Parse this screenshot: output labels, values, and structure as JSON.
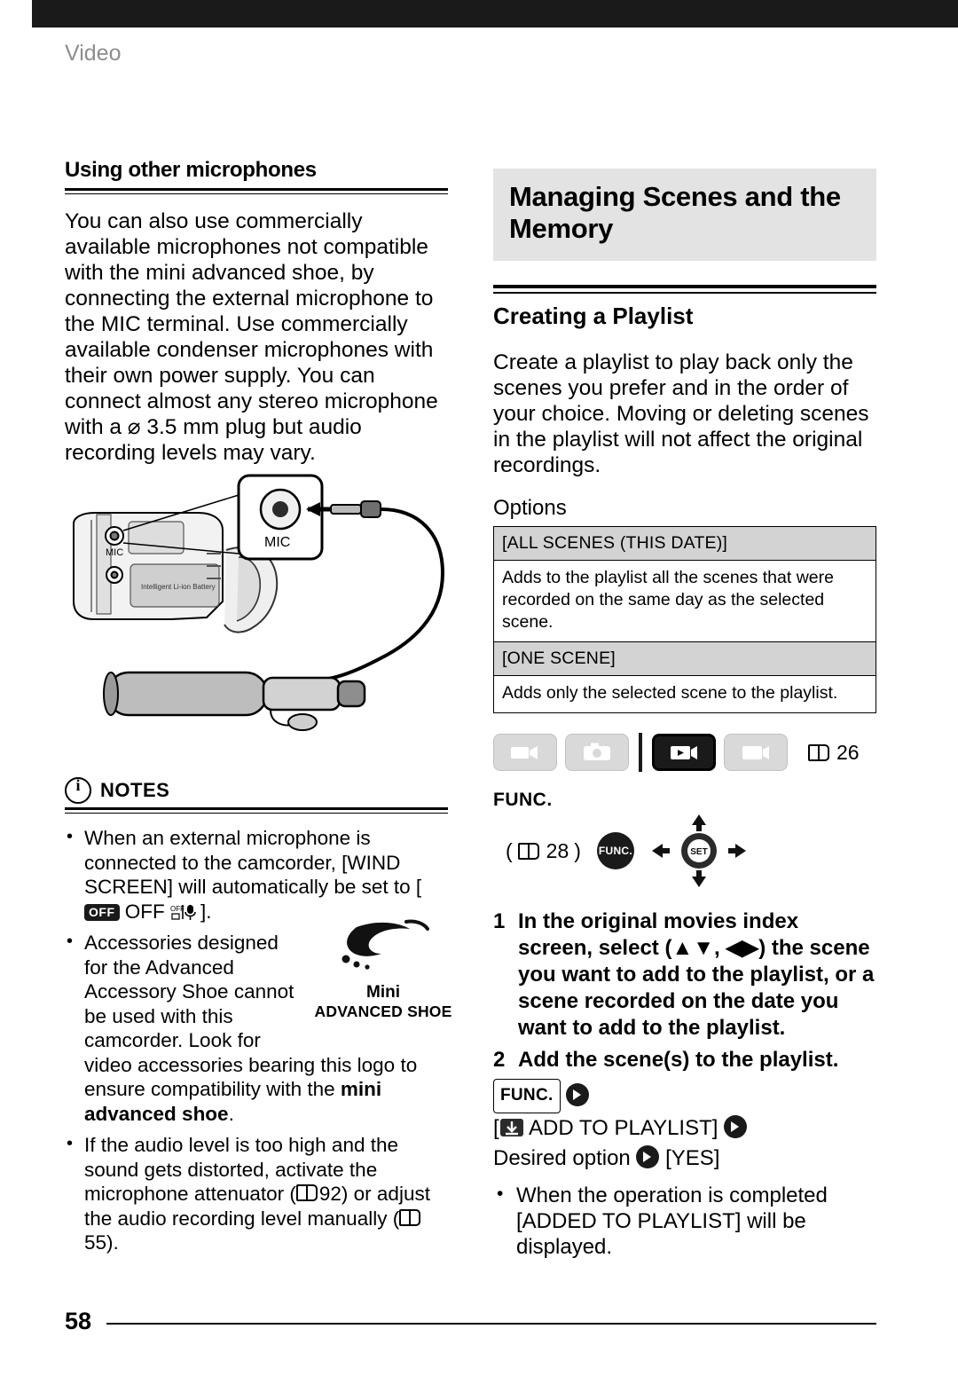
{
  "running_head": "Video",
  "page_number": "58",
  "left": {
    "sub_head": "Using other microphones",
    "body": "You can also use commercially available microphones not compatible with the mini advanced shoe, by connecting the external microphone to the MIC terminal. Use commercially available condenser microphones with their own power supply. You can connect almost any stereo microphone with a ⌀ 3.5 mm plug but audio recording levels may vary.",
    "illustration": {
      "mic_callout_label": "MIC",
      "camera_mic_label": "MIC",
      "battery_label": "Intelligent Li-ion Battery"
    },
    "notes_title": "NOTES",
    "notes": [
      {
        "parts_before": "When an external microphone is connected to the camcorder, [WIND SCREEN] will automatically be set to [",
        "badge": "OFF",
        "parts_after": " OFF",
        "tail": "]."
      },
      {
        "text": "Accessories designed for the Advanced Accessory Shoe cannot be used with this camcorder. Look for video accessories bearing this logo to ensure compatibility with the mini advanced shoe."
      },
      {
        "text": "If the audio level is too high and the sound gets distorted, activate the microphone attenuator (",
        "ref1": "92",
        "mid": ") or adjust the audio recording level manually (",
        "ref2": "55",
        "tail": ")."
      }
    ],
    "shoe_logo": {
      "mini": "Mini",
      "advanced_shoe": "ADVANCED SHOE"
    }
  },
  "right": {
    "chapter_title_line1": "Managing Scenes and the",
    "chapter_title_line2": "Memory",
    "section_title": "Creating a Playlist",
    "intro": "Create a playlist to play back only the scenes you prefer and in the order of your choice. Moving or deleting scenes in the playlist will not affect the original recordings.",
    "options_label": "Options",
    "options_table": [
      {
        "header": "[ALL SCENES (THIS DATE)]",
        "description": "Adds to the playlist all the scenes that were recorded on the same day as the selected scene."
      },
      {
        "header": "[ONE SCENE]",
        "description": "Adds only the selected scene to the playlist."
      }
    ],
    "mode_buttons": [
      {
        "name": "movie-record-mode",
        "icon": "camcorder-icon",
        "active": false
      },
      {
        "name": "photo-record-mode",
        "icon": "camera-icon",
        "active": false
      },
      {
        "name": "movie-playback-mode",
        "icon": "movie-playback-icon",
        "active": true
      },
      {
        "name": "photo-playback-mode",
        "icon": "photo-playback-icon",
        "active": false
      }
    ],
    "mode_page_ref": "26",
    "func_label": "FUNC.",
    "func_page_ref": "28",
    "func_button_text": "FUNC.",
    "joystick_center_label": "SET",
    "steps": [
      {
        "num": "1",
        "text": "In the original movies index screen, select (▲▼, ◀▶) the scene you want to add to the playlist, or a scene recorded on the date you want to add to the playlist."
      },
      {
        "num": "2",
        "text": "Add the scene(s) to the playlist."
      }
    ],
    "sequence": {
      "func_box": "FUNC.",
      "line2_before": "[",
      "line2_label": "ADD TO PLAYLIST]",
      "line3": "Desired option",
      "line3_tail": "[YES]"
    },
    "completion_note": "When the operation is completed [ADDED TO PLAYLIST] will be displayed."
  },
  "colors": {
    "running_head": "#8d8d8d",
    "chapter_box_bg": "#e3e3e3",
    "table_header_bg": "#d3d3d3",
    "ink": "#000000"
  }
}
